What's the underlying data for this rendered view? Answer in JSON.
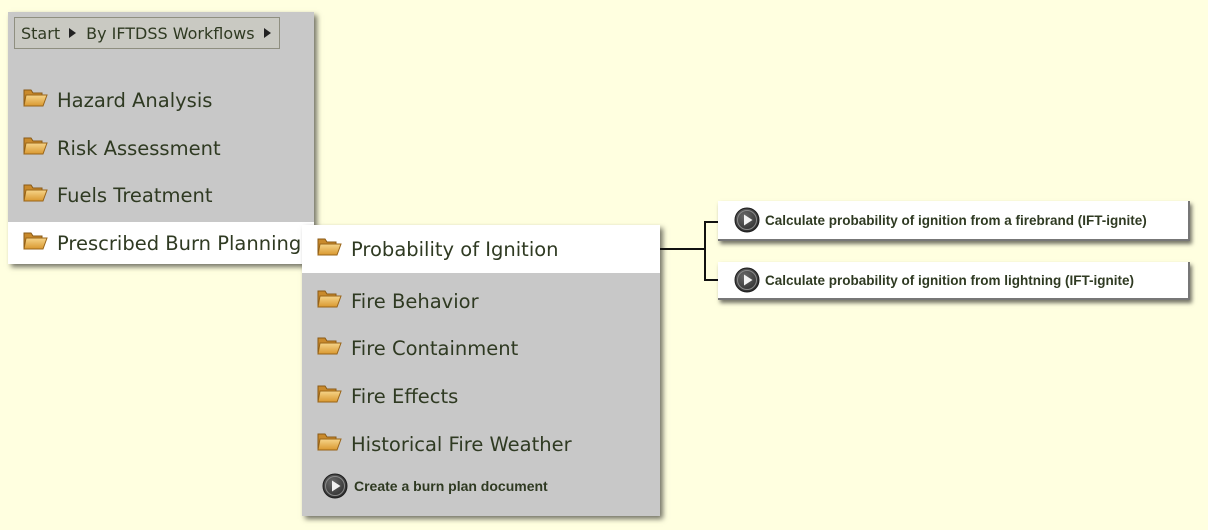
{
  "breadcrumb": {
    "items": [
      "Start",
      "By IFTDSS Workflows"
    ]
  },
  "main_menu": {
    "items": [
      {
        "label": "Hazard Analysis"
      },
      {
        "label": "Risk Assessment"
      },
      {
        "label": "Fuels Treatment"
      },
      {
        "label": "Prescribed Burn Planning",
        "selected": true
      }
    ]
  },
  "sub_menu": {
    "items": [
      {
        "label": "Probability of Ignition",
        "selected": true
      },
      {
        "label": "Fire Behavior"
      },
      {
        "label": "Fire Containment"
      },
      {
        "label": "Fire Effects"
      },
      {
        "label": "Historical Fire Weather"
      }
    ],
    "action": "Create a burn plan document"
  },
  "actions": [
    {
      "label": "Calculate probability of ignition from a firebrand (IFT-ignite)"
    },
    {
      "label": "Calculate probability of ignition from lightning (IFT-ignite)"
    }
  ],
  "colors": {
    "background": "#ffffe0",
    "panel": "#c8c8c8",
    "selected": "#ffffff",
    "text": "#2f3a22"
  },
  "icons": {
    "folder": "folder-open-icon",
    "play": "play-circle-icon",
    "breadcrumb_separator": "triangle-right-icon"
  }
}
